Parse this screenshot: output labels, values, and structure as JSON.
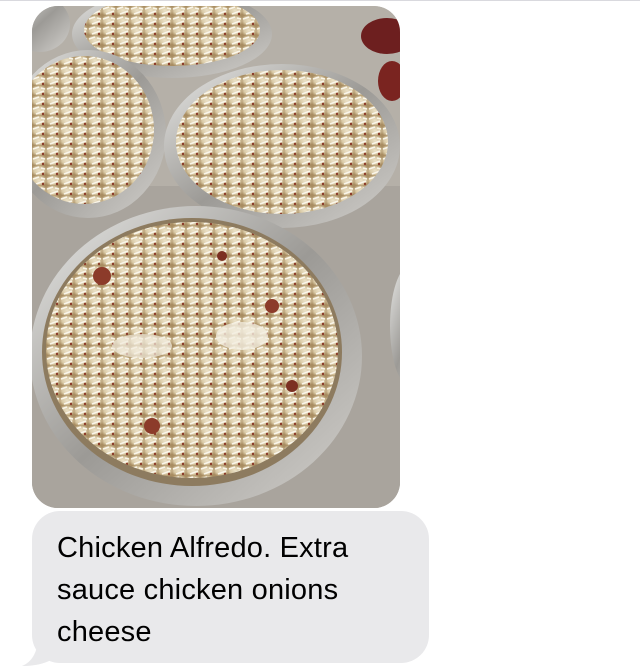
{
  "conversation": {
    "messages": [
      {
        "kind": "image",
        "direction": "incoming",
        "image_description_icon": "food-photo"
      },
      {
        "kind": "text",
        "direction": "incoming",
        "text": "Chicken Alfredo. Extra sauce chicken onions cheese"
      }
    ]
  },
  "colors": {
    "incoming_bubble": "#e9e9eb",
    "background": "#ffffff",
    "text": "#000000"
  }
}
